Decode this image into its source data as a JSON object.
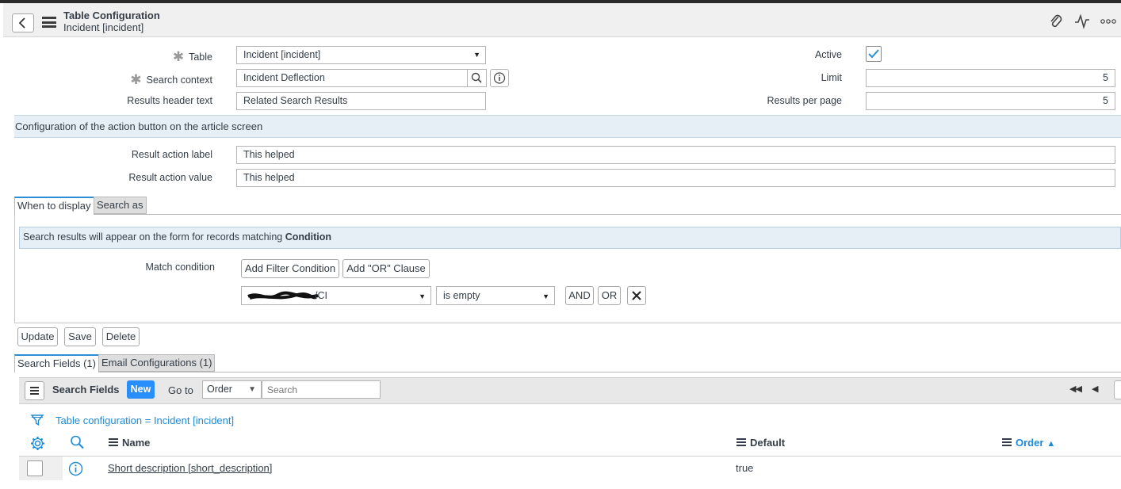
{
  "header": {
    "title": "Table Configuration",
    "subtitle": "Incident [incident]"
  },
  "form": {
    "table_label": "Table",
    "table_value": "Incident [incident]",
    "search_context_label": "Search context",
    "search_context_value": "Incident Deflection",
    "results_header_label": "Results header text",
    "results_header_value": "Related Search Results",
    "active_label": "Active",
    "active_checked": true,
    "limit_label": "Limit",
    "limit_value": "5",
    "results_per_page_label": "Results per page",
    "results_per_page_value": "5"
  },
  "action_section": {
    "title": "Configuration of the action button on the article screen",
    "result_action_label_label": "Result action label",
    "result_action_label_value": "This helped",
    "result_action_value_label": "Result action value",
    "result_action_value_value": "This helped"
  },
  "display_tabs": [
    "When to display",
    "Search as"
  ],
  "condition": {
    "info_prefix": "Search results will appear on the form for records matching ",
    "info_bold": "Condition",
    "match_label": "Match condition",
    "add_filter": "Add Filter Condition",
    "add_or": "Add \"OR\" Clause",
    "field_value": "/CI",
    "operator_value": "is empty",
    "and_label": "AND",
    "or_label": "OR"
  },
  "actions": {
    "update": "Update",
    "save": "Save",
    "delete": "Delete"
  },
  "related_tabs": [
    "Search Fields (1)",
    "Email Configurations (1)"
  ],
  "list": {
    "title": "Search Fields",
    "new_label": "New",
    "goto_label": "Go to",
    "goto_value": "Order",
    "search_placeholder": "Search",
    "breadcrumb": "Table configuration = Incident [incident]",
    "columns": {
      "name": "Name",
      "default": "Default",
      "order": "Order"
    },
    "rows": [
      {
        "name": "Short description [short_description]",
        "default": "true"
      }
    ]
  },
  "colors": {
    "accent": "#2c8fd5",
    "new_button": "#278efc",
    "link": "#1f8ad6"
  }
}
